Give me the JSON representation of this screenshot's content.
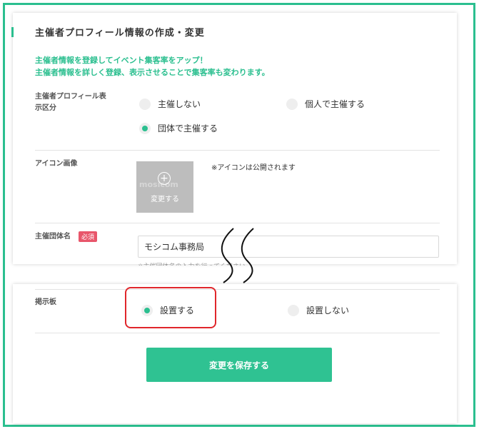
{
  "page": {
    "title": "主催者プロフィール情報の作成・変更"
  },
  "intro": {
    "line1": "主催者情報を登録してイベント集客率をアップ！",
    "line2": "主催者情報を詳しく登録、表示させることで集客率も変わります。"
  },
  "display_type": {
    "label_line1": "主催者プロフィール表",
    "label_line2": "示区分",
    "options": [
      {
        "label": "主催しない",
        "selected": false
      },
      {
        "label": "個人で主催する",
        "selected": false
      },
      {
        "label": "団体で主催する",
        "selected": true
      }
    ]
  },
  "icon_image": {
    "label": "アイコン画像",
    "placeholder_logo": "mosicom",
    "change_label": "変更する",
    "note": "※アイコンは公開されます"
  },
  "org_name": {
    "label": "主催団体名",
    "required_badge": "必須",
    "value": "モシコム事務局",
    "hint": "※主催団体名の入力を行ってください"
  },
  "board": {
    "label": "掲示板",
    "options": [
      {
        "label": "設置する",
        "selected": true
      },
      {
        "label": "設置しない",
        "selected": false
      }
    ]
  },
  "actions": {
    "save_label": "変更を保存する"
  },
  "colors": {
    "accent": "#2bbf8f",
    "highlight": "#e0262b",
    "badge": "#e8566b"
  }
}
